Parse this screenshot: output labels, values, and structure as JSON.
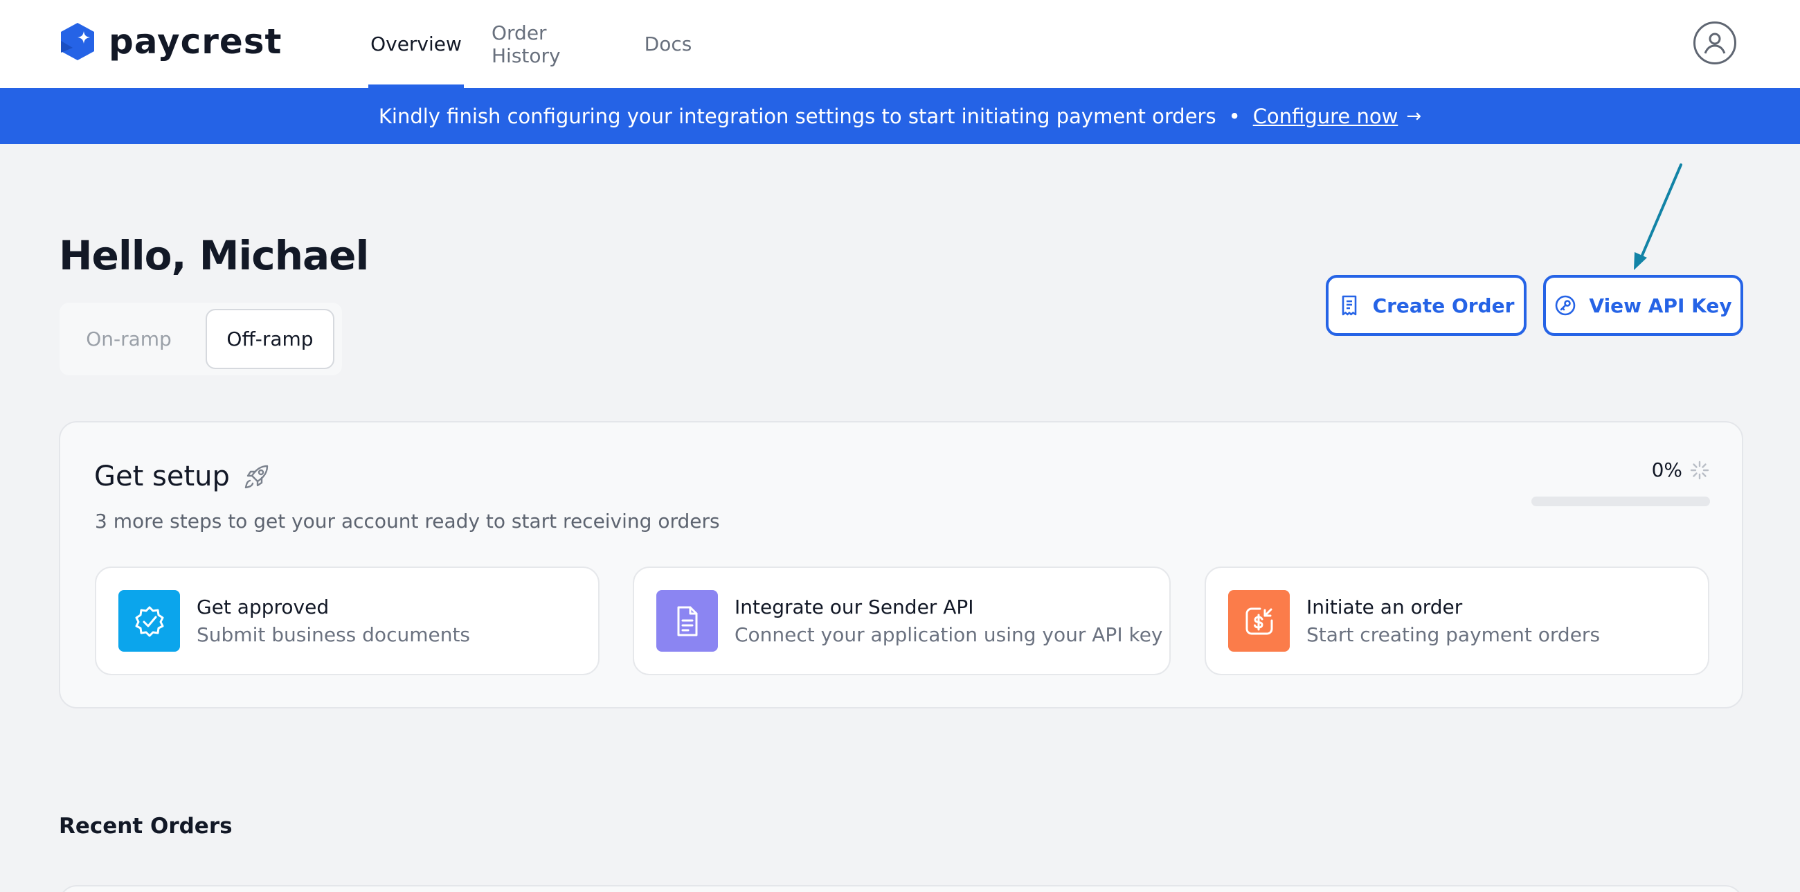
{
  "app": {
    "brand": "paycrest",
    "accent_color": "#2563e6"
  },
  "nav": {
    "tabs": [
      {
        "label": "Overview",
        "active": true
      },
      {
        "label": "Order History",
        "active": false
      },
      {
        "label": "Docs",
        "active": false
      }
    ],
    "avatar_icon": "user-circle-icon"
  },
  "banner": {
    "message": "Kindly finish configuring your integration settings to start initiating payment orders",
    "separator": "•",
    "link_label": "Configure now",
    "link_arrow": "→"
  },
  "greeting": "Hello, Michael",
  "ramp_toggle": {
    "options": [
      "On-ramp",
      "Off-ramp"
    ],
    "selected": "Off-ramp"
  },
  "actions": {
    "create_order": {
      "label": "Create Order",
      "icon": "receipt-icon"
    },
    "view_api_key": {
      "label": "View API Key",
      "icon": "key-icon"
    }
  },
  "setup": {
    "title": "Get setup",
    "title_icon": "rocket-icon",
    "subtitle": "3 more steps to get your account ready to start receiving orders",
    "progress_label": "0%",
    "progress_value": 0,
    "steps": [
      {
        "title": "Get approved",
        "description": "Submit business documents",
        "icon": "badge-check-icon",
        "color": "#0ba5ec"
      },
      {
        "title": "Integrate our Sender API",
        "description": "Connect your application using your API key",
        "icon": "document-icon",
        "color": "#8b85f2"
      },
      {
        "title": "Initiate an order",
        "description": "Start creating payment orders",
        "icon": "payment-order-icon",
        "color": "#fb7c4a"
      }
    ]
  },
  "recent_orders": {
    "title": "Recent Orders"
  }
}
